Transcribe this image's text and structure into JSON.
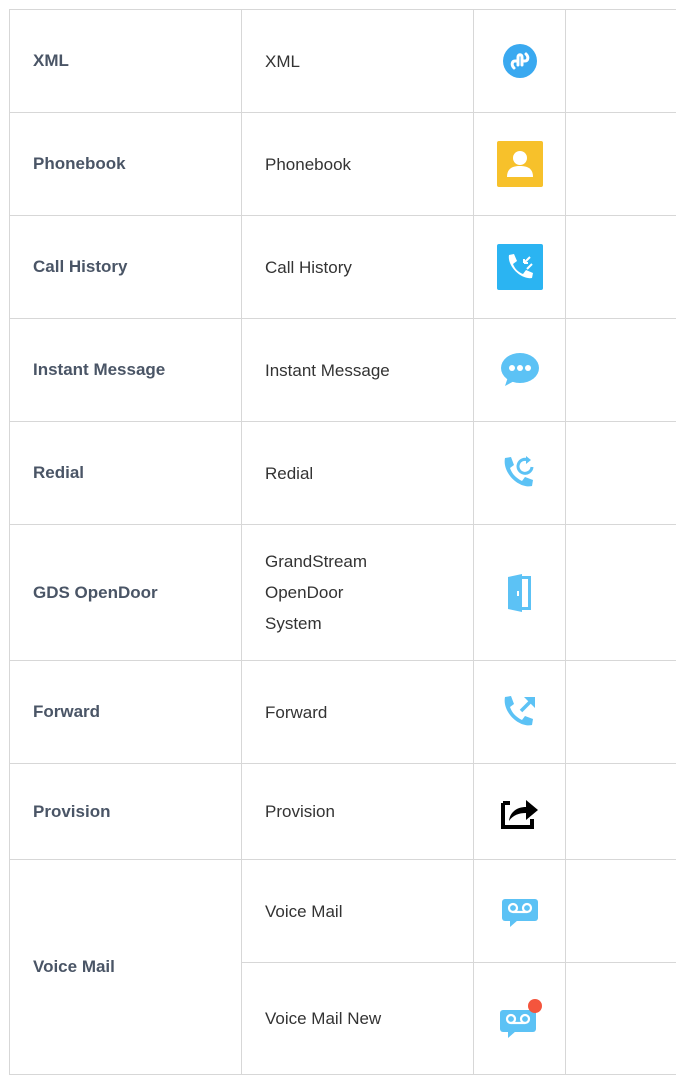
{
  "rows": [
    {
      "name": "XML",
      "description": "XML",
      "icon": "xml-link-icon",
      "color": "#3aa9f0"
    },
    {
      "name": "Phonebook",
      "description": "Phonebook",
      "icon": "contact-icon",
      "color": "#f7c12b"
    },
    {
      "name": "Call History",
      "description": "Call History",
      "icon": "call-history-icon",
      "color": "#2bb4f2"
    },
    {
      "name": "Instant Message",
      "description": "Instant Message",
      "icon": "chat-bubble-icon",
      "color": "#5cc2f5"
    },
    {
      "name": "Redial",
      "description": "Redial",
      "icon": "redial-icon",
      "color": "#5cc2f5"
    },
    {
      "name": "GDS OpenDoor",
      "description_lines": [
        "GrandStream",
        "OpenDoor",
        "System"
      ],
      "icon": "door-icon",
      "color": "#5cc2f5"
    },
    {
      "name": "Forward",
      "description": "Forward",
      "icon": "call-forward-icon",
      "color": "#5cc2f5"
    },
    {
      "name": "Provision",
      "description": "Provision",
      "icon": "share-arrow-icon",
      "color": "#000000"
    },
    {
      "name": "Voice Mail",
      "sub": [
        {
          "description": "Voice Mail",
          "icon": "voicemail-icon",
          "color": "#5cc2f5"
        },
        {
          "description": "Voice Mail New",
          "icon": "voicemail-new-icon",
          "color": "#5cc2f5",
          "badge_color": "#f4553d"
        }
      ]
    }
  ]
}
